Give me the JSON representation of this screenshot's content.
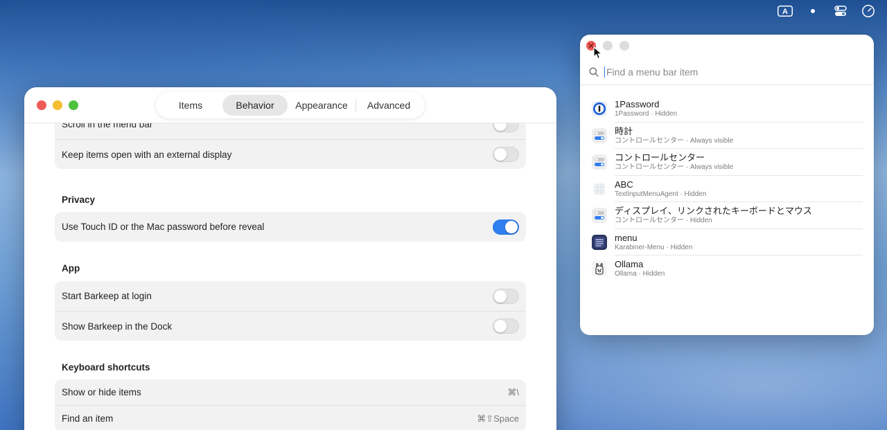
{
  "menubar": {
    "icons": [
      "input-source-a-icon",
      "dot-icon",
      "control-center-icon",
      "clock-icon"
    ],
    "input_source_letter": "A"
  },
  "settings": {
    "tabs": [
      {
        "label": "Items"
      },
      {
        "label": "Behavior",
        "active": true
      },
      {
        "label": "Appearance"
      },
      {
        "label": "Advanced"
      }
    ],
    "rows_top": [
      {
        "label": "Scroll in the menu bar",
        "toggle": false
      },
      {
        "label": "Keep items open with an external display",
        "toggle": false
      }
    ],
    "privacy": {
      "title": "Privacy",
      "rows": [
        {
          "label": "Use Touch ID or the Mac password before reveal",
          "toggle": true
        }
      ]
    },
    "app": {
      "title": "App",
      "rows": [
        {
          "label": "Start Barkeep at login",
          "toggle": false
        },
        {
          "label": "Show Barkeep in the Dock",
          "toggle": false
        }
      ]
    },
    "shortcuts": {
      "title": "Keyboard shortcuts",
      "rows": [
        {
          "label": "Show or hide items",
          "shortcut": "⌘\\"
        },
        {
          "label": "Find an item",
          "shortcut": "⌘⇧Space"
        }
      ]
    }
  },
  "finder": {
    "search": {
      "placeholder": "Find a menu bar item",
      "value": ""
    },
    "results": [
      {
        "title": "1Password",
        "subtitle": "1Password · Hidden",
        "icon": "1password-icon"
      },
      {
        "title": "時計",
        "subtitle": "コントロールセンター · Always visible",
        "icon": "control-center-icon"
      },
      {
        "title": "コントロールセンター",
        "subtitle": "コントロールセンター · Always visible",
        "icon": "control-center-icon"
      },
      {
        "title": "ABC",
        "subtitle": "TextInputMenuAgent · Hidden",
        "icon": "input-menu-icon"
      },
      {
        "title": "ディスプレイ、リンクされたキーボードとマウス",
        "subtitle": "コントロールセンター · Hidden",
        "icon": "control-center-icon"
      },
      {
        "title": "menu",
        "subtitle": "Karabiner-Menu · Hidden",
        "icon": "karabiner-icon"
      },
      {
        "title": "Ollama",
        "subtitle": "Ollama · Hidden",
        "icon": "ollama-icon"
      }
    ]
  },
  "colors": {
    "accent": "#2f7ff0",
    "close": "#ee5b56",
    "minimize": "#f5bd31",
    "zoom": "#4fc23f"
  }
}
